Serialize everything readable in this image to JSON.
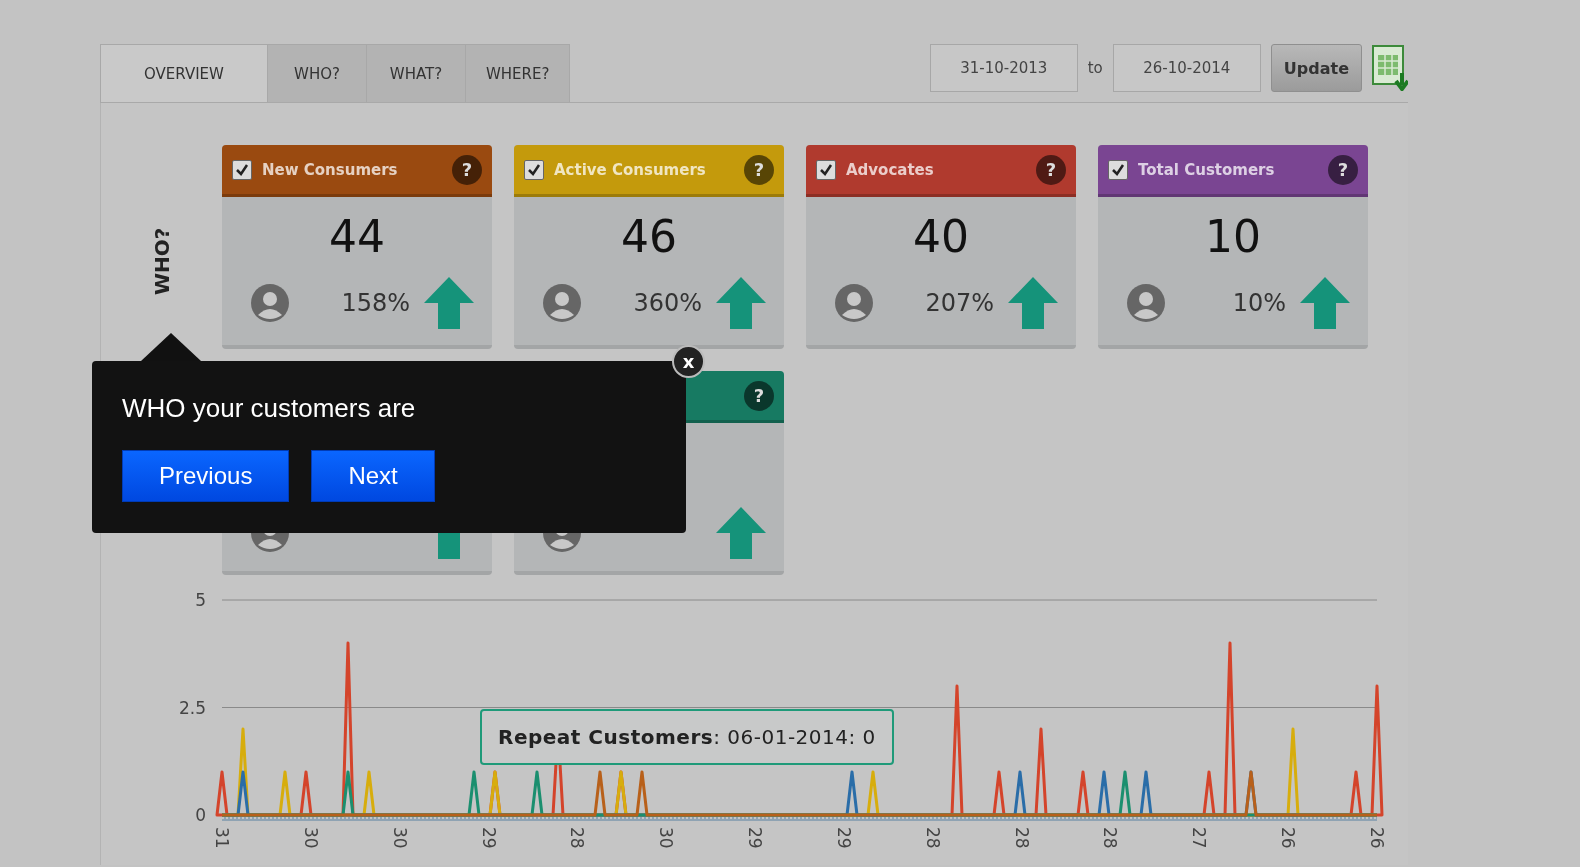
{
  "tabs": [
    {
      "label": "OVERVIEW",
      "selected": true
    },
    {
      "label": "WHO?",
      "selected": false
    },
    {
      "label": "WHAT?",
      "selected": false
    },
    {
      "label": "WHERE?",
      "selected": false
    }
  ],
  "date_range": {
    "from": "31-10-2013",
    "separator": "to",
    "to": "26-10-2014",
    "button": "Update"
  },
  "section_label": "WHO?",
  "cards": [
    {
      "title": "New Consumers",
      "checked": true,
      "help": "?",
      "value": "44",
      "change": "158%",
      "color": "#9a4a10"
    },
    {
      "title": "Active Consumers",
      "checked": true,
      "help": "?",
      "value": "46",
      "change": "360%",
      "color": "#c49a0c"
    },
    {
      "title": "Advocates",
      "checked": true,
      "help": "?",
      "value": "40",
      "change": "207%",
      "color": "#b03a2e"
    },
    {
      "title": "Total Customers",
      "checked": true,
      "help": "?",
      "value": "10",
      "change": "10%",
      "color": "#7a4592"
    }
  ],
  "covered_card": {
    "help": "?",
    "color": "#177a62"
  },
  "tour_tooltip": {
    "text": "WHO your customers are",
    "close": "x",
    "buttons": [
      "Previous",
      "Next"
    ]
  },
  "chart": {
    "hover_tooltip": "**Repeat Customers**: 06-01-2014: 0",
    "y_axis_labels": [
      "5",
      "2.5",
      "0"
    ],
    "x_axis_labels": [
      "31",
      "30",
      "30",
      "29",
      "28",
      "30",
      "29",
      "29",
      "28",
      "28",
      "28",
      "27",
      "26",
      "26"
    ]
  }
}
